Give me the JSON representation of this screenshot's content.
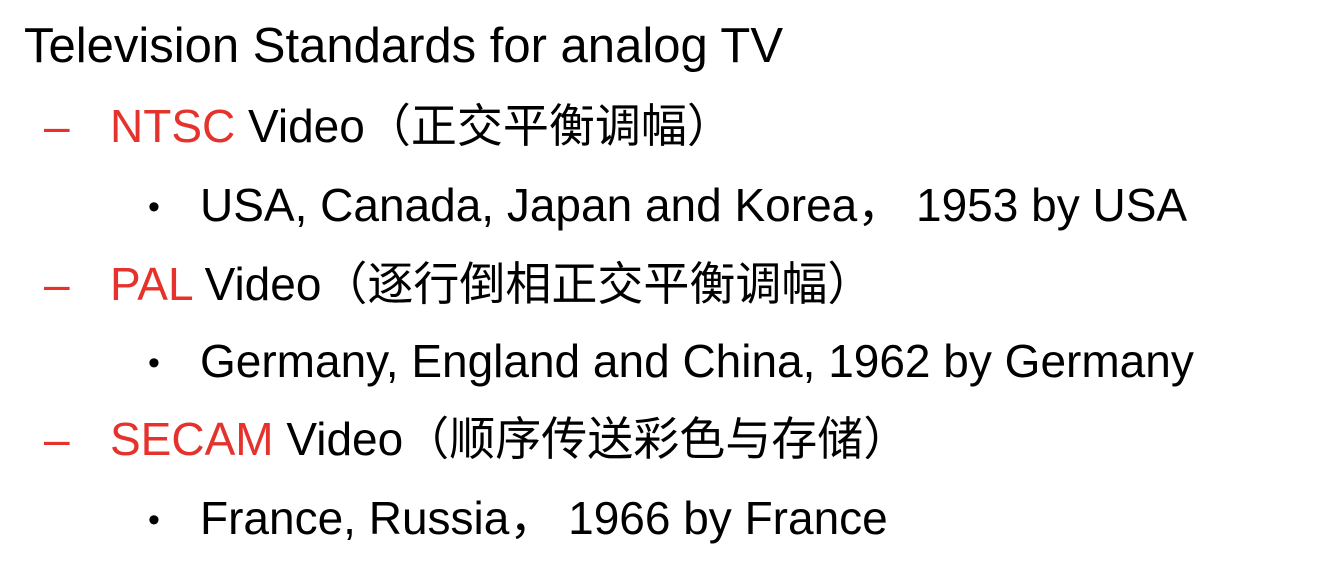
{
  "title": "Television Standards for analog TV",
  "colors": {
    "accent": "#e5322d",
    "text": "#000000",
    "background": "#ffffff"
  },
  "dash_symbol": "–",
  "bullet_symbol": "•",
  "standards": [
    {
      "name": "NTSC",
      "rest": " Video（正交平衡调幅）",
      "detail": "USA, Canada, Japan and Korea， 1953 by USA"
    },
    {
      "name": "PAL",
      "rest": " Video（逐行倒相正交平衡调幅）",
      "detail": "Germany, England and China, 1962 by Germany"
    },
    {
      "name": "SECAM",
      "rest": " Video（顺序传送彩色与存储）",
      "detail": "France, Russia， 1966 by France"
    }
  ]
}
